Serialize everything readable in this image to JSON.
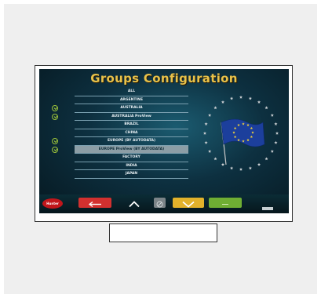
{
  "screen": {
    "title": "Groups Configuration",
    "groups": [
      {
        "label": "ALL",
        "checked": false,
        "selected": false
      },
      {
        "label": "ARGENTINE",
        "checked": false,
        "selected": false
      },
      {
        "label": "AUSTRALIA",
        "checked": true,
        "selected": false
      },
      {
        "label": "AUSTRALIA ProView",
        "checked": true,
        "selected": false
      },
      {
        "label": "BRAZIL",
        "checked": false,
        "selected": false
      },
      {
        "label": "CHINA",
        "checked": false,
        "selected": false
      },
      {
        "label": "EUROPE (BY AUTODATA)",
        "checked": true,
        "selected": false
      },
      {
        "label": "EUROPE ProView (BY AUTODATA)",
        "checked": true,
        "selected": true
      },
      {
        "label": "FACTORY",
        "checked": false,
        "selected": false
      },
      {
        "label": "INDIA",
        "checked": false,
        "selected": false
      },
      {
        "label": "JAPAN",
        "checked": false,
        "selected": false
      }
    ],
    "flag_icon": "eu-flag-icon"
  },
  "toolbar": {
    "logo_text": "Hunter",
    "back_icon": "arrow-left-icon",
    "up_icon": "chevron-up-icon",
    "clear_icon": "clear-icon",
    "down_icon": "chevron-down-icon",
    "ok_icon": "ok-icon"
  },
  "colors": {
    "title": "#e8c24a",
    "back": "#d2302f",
    "down": "#e2b22b",
    "ok": "#6fae33",
    "check": "#9dc33b",
    "selected_row": "#8c9ea6"
  }
}
